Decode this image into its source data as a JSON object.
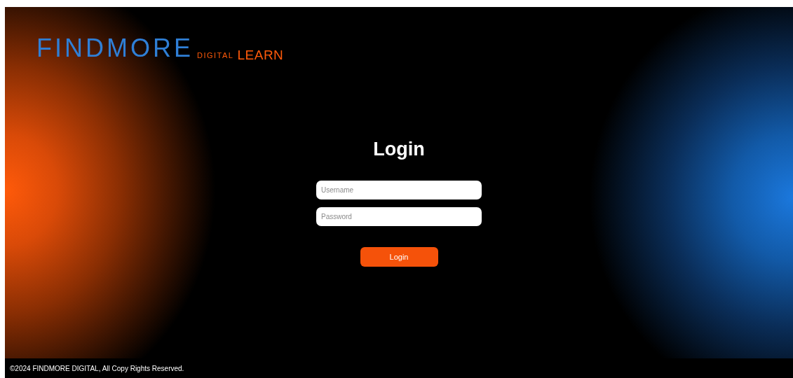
{
  "logo": {
    "wordmark": "FINDMORE",
    "subtitle": "DIGITAL",
    "product": "LEARN"
  },
  "login": {
    "title": "Login",
    "fields": [
      {
        "placeholder": "Username"
      },
      {
        "placeholder": "Password"
      }
    ],
    "button": "Login"
  },
  "footer": "©2024 FINDMORE DIGITAL, All Copy Rights Reserved."
}
